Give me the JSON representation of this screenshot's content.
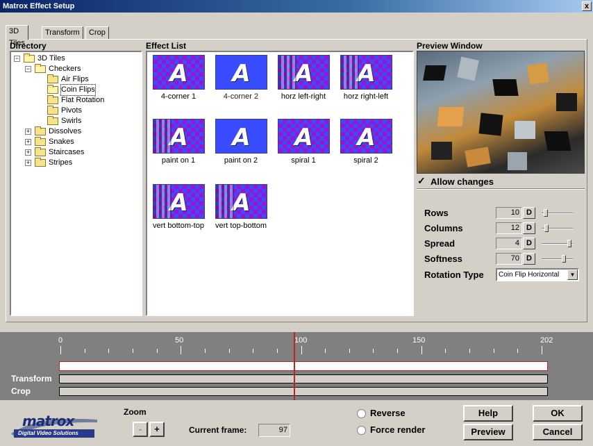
{
  "window": {
    "title": "Matrox Effect Setup",
    "close_glyph": "x"
  },
  "tabs": [
    "3D Tiles",
    "Transform",
    "Crop"
  ],
  "directory": {
    "title": "Directory",
    "root": "3D Tiles",
    "checkers": "Checkers",
    "children": [
      "Air Flips",
      "Coin Flips",
      "Flat Rotation",
      "Pivots",
      "Swirls"
    ],
    "others": [
      "Dissolves",
      "Snakes",
      "Staircases",
      "Stripes"
    ],
    "selected": "Coin Flips"
  },
  "effects": {
    "title": "Effect List",
    "items": [
      "4-corner 1",
      "4-corner 2",
      "horz left-right",
      "horz right-left",
      "paint on 1",
      "paint on 2",
      "spiral 1",
      "spiral 2",
      "vert bottom-top",
      "vert top-bottom"
    ],
    "selected": "4-corner 2",
    "thumb_glyph": "A"
  },
  "preview": {
    "title": "Preview Window",
    "allow_changes": "Allow changes",
    "allow_checked": true
  },
  "params": {
    "rows": {
      "label": "Rows",
      "value": "10",
      "slider": 0.1
    },
    "columns": {
      "label": "Columns",
      "value": "12",
      "slider": 0.12
    },
    "spread": {
      "label": "Spread",
      "value": "4",
      "slider": 0.9
    },
    "softness": {
      "label": "Softness",
      "value": "70",
      "slider": 0.7
    },
    "rotation": {
      "label": "Rotation Type",
      "value": "Coin Flip Horizontal"
    },
    "default_btn": "D"
  },
  "timeline": {
    "ticks": [
      "0",
      "50",
      "100",
      "150",
      "202"
    ],
    "tracks": [
      "Transform",
      "Crop"
    ],
    "current_frame_value": 97,
    "max_frame": 202
  },
  "controls": {
    "zoom": "Zoom",
    "zoom_out": "-",
    "zoom_in": "+",
    "current_frame_label": "Current frame:",
    "current_frame": "97",
    "reverse": "Reverse",
    "force_render": "Force render",
    "help": "Help",
    "preview": "Preview",
    "ok": "OK",
    "cancel": "Cancel"
  },
  "logo": {
    "brand": "matrox",
    "tagline": "Digital Video Solutions"
  },
  "colors": {
    "title_bar": "#0a246a",
    "accent_red": "#b22222",
    "thumb_blue": "#3a4cff",
    "thumb_purple": "#9b14c9"
  }
}
